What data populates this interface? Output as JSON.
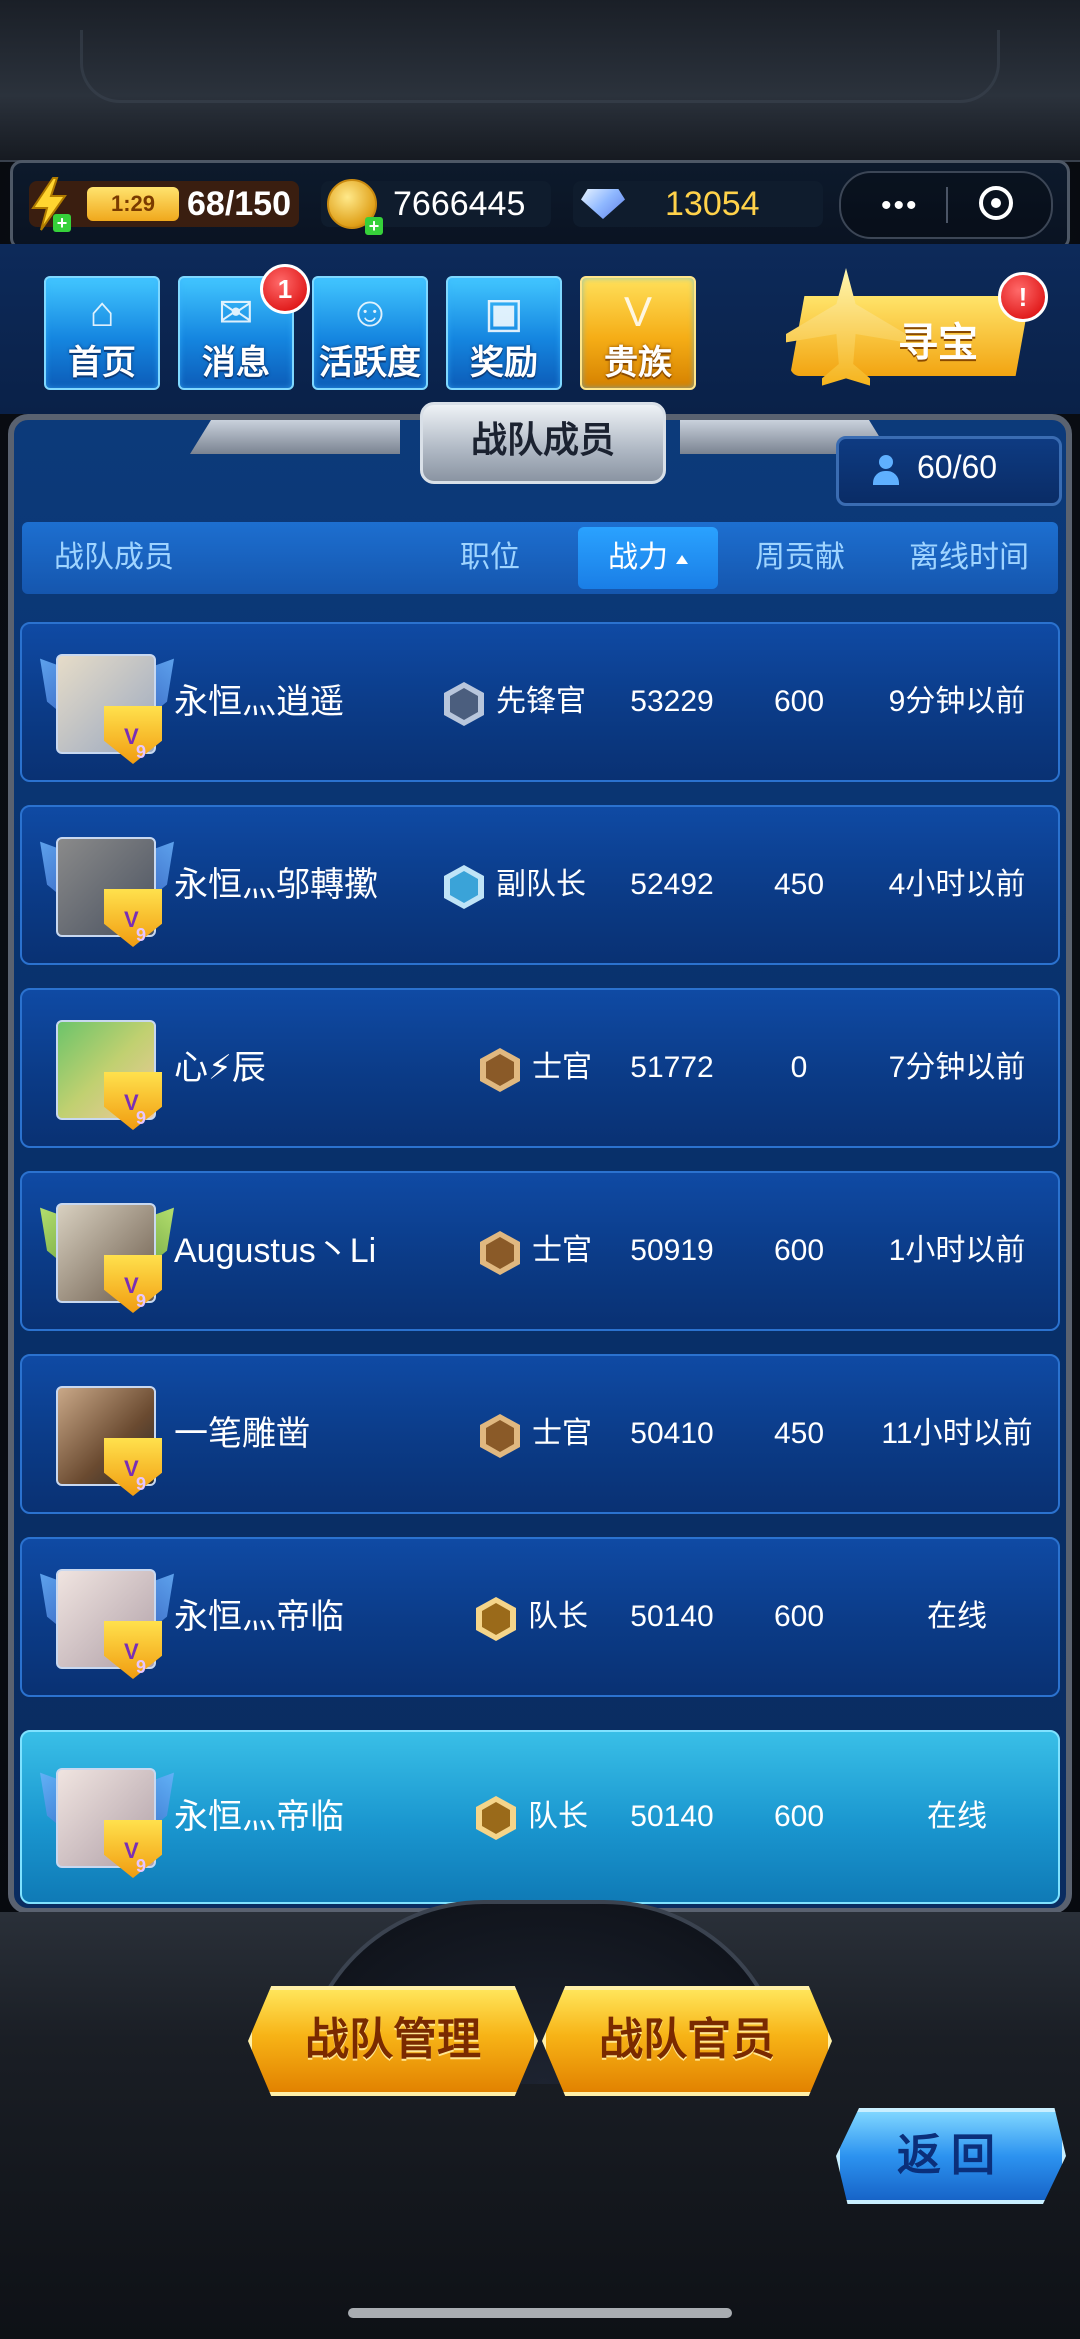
{
  "status": {
    "energy_time": "1:29",
    "energy_value": "68/150",
    "gold": "7666445",
    "diamonds": "13054",
    "capsule_more": "•••"
  },
  "nav": {
    "home": "首页",
    "messages": "消息",
    "messages_badge": "1",
    "activity": "活跃度",
    "rewards": "奖励",
    "noble": "贵族",
    "treasure": "寻宝",
    "treasure_badge": "!"
  },
  "panel": {
    "title": "战队成员",
    "member_count": "60/60"
  },
  "table": {
    "headers": {
      "name": "战队成员",
      "position": "职位",
      "power": "战力",
      "week": "周贡献",
      "offline": "离线时间"
    },
    "rows": [
      {
        "name": "永恒灬逍遥",
        "position": "先锋官",
        "power": "53229",
        "week": "600",
        "offline": "9分钟以前",
        "rank_color": "#6a7e9c"
      },
      {
        "name": "永恒灬邬轉擹",
        "position": "副队长",
        "power": "52492",
        "week": "450",
        "offline": "4小时以前",
        "rank_color": "#3aa3d8"
      },
      {
        "name": "心⚡辰",
        "position": "士官",
        "power": "51772",
        "week": "0",
        "offline": "7分钟以前",
        "rank_color": "#a8703a"
      },
      {
        "name": "Augustus丶Li",
        "position": "士官",
        "power": "50919",
        "week": "600",
        "offline": "1小时以前",
        "rank_color": "#a8703a"
      },
      {
        "name": "一笔雕凿",
        "position": "士官",
        "power": "50410",
        "week": "450",
        "offline": "11小时以前",
        "rank_color": "#a8703a"
      },
      {
        "name": "永恒灬帝临",
        "position": "队长",
        "power": "50140",
        "week": "600",
        "offline": "在线",
        "rank_color": "#d4a23a"
      },
      {
        "name": "永恒灬帝临",
        "position": "队长",
        "power": "50140",
        "week": "600",
        "offline": "在线",
        "rank_color": "#d4a23a"
      }
    ]
  },
  "buttons": {
    "team_manage": "战队管理",
    "team_officers": "战队官员",
    "back": "返回"
  },
  "colors": {
    "accent_blue": "#1a7ee6",
    "gold": "#f7b316",
    "highlight_row": "#1a96cf",
    "badge_red": "#d60000"
  },
  "icons": [
    "lightning-icon",
    "coin-icon",
    "diamond-icon",
    "more-icon",
    "target-icon",
    "members-icon",
    "sort-up-icon",
    "rank-insignia-icon",
    "fighter-jet-icon"
  ]
}
